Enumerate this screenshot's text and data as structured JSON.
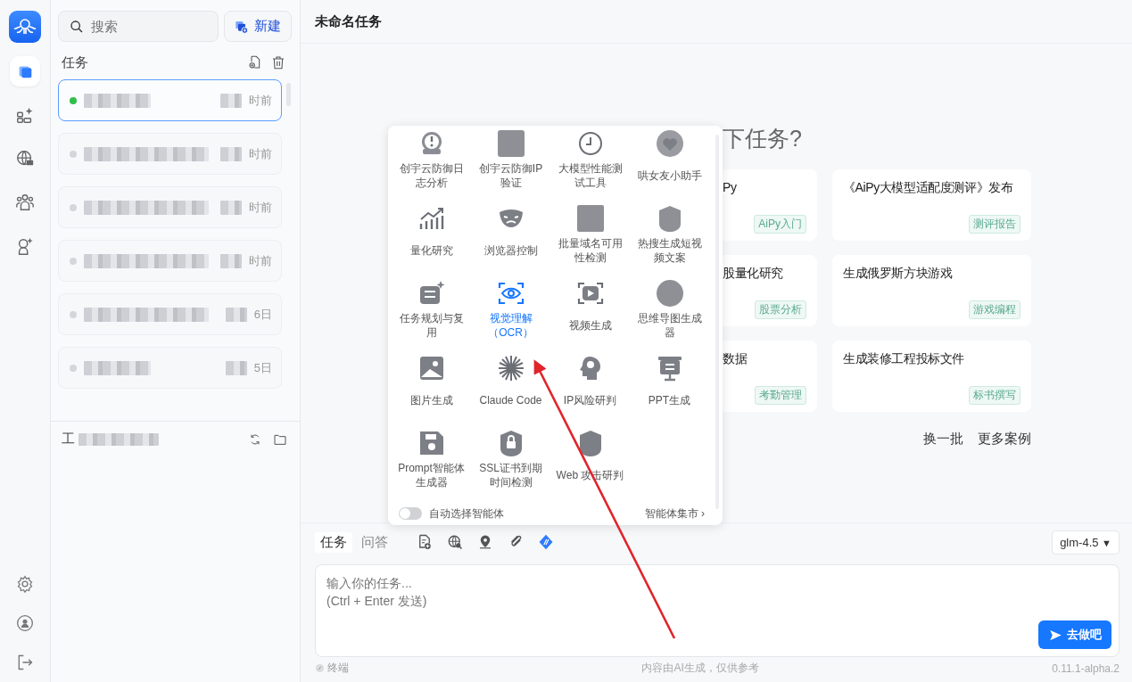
{
  "rail": {
    "items": [
      {
        "selected": true
      },
      {
        "selected": false
      },
      {
        "selected": false
      },
      {
        "selected": false
      },
      {
        "selected": false
      }
    ]
  },
  "sidebar": {
    "search": {
      "placeholder": "搜索"
    },
    "new_button": "新建",
    "section_title": "任务",
    "tasks": [
      {
        "time": "时前",
        "selected": true,
        "color": "#2fbf4a"
      },
      {
        "time": "时前",
        "selected": false,
        "color": "#d4d6da"
      },
      {
        "time": "时前",
        "selected": false,
        "color": "#d4d6da"
      },
      {
        "time": "时前",
        "selected": false,
        "color": "#d4d6da"
      },
      {
        "time": "6日",
        "selected": false,
        "color": "#d4d6da"
      },
      {
        "time": "5日",
        "selected": false,
        "color": "#d4d6da"
      }
    ],
    "workspace_label": "工"
  },
  "window": {
    "title": "未命名任务"
  },
  "welcome": {
    "heading": "下任务?",
    "cards": [
      {
        "title": "Py",
        "tag": "AiPy入门"
      },
      {
        "title": "《AiPy大模型适配度测评》发布",
        "tag": "测评报告"
      },
      {
        "title": "股量化研究",
        "tag": "股票分析"
      },
      {
        "title": "生成俄罗斯方块游戏",
        "tag": "游戏编程"
      },
      {
        "title": "数据",
        "tag": "考勤管理"
      },
      {
        "title": "生成装修工程投标文件",
        "tag": "标书撰写"
      }
    ],
    "links": [
      "换一批",
      "更多案例"
    ]
  },
  "agent_menu": {
    "items": [
      {
        "label": "创宇云防御日志分析",
        "selected": false
      },
      {
        "label": "创宇云防御IP验证",
        "selected": false
      },
      {
        "label": "大模型性能测试工具",
        "selected": false
      },
      {
        "label": "哄女友小助手",
        "selected": false
      },
      {
        "label": "量化研究",
        "selected": false
      },
      {
        "label": "浏览器控制",
        "selected": false
      },
      {
        "label": "批量域名可用性检测",
        "selected": false
      },
      {
        "label": "热搜生成短视频文案",
        "selected": false
      },
      {
        "label": "任务规划与复用",
        "selected": false
      },
      {
        "label": "视觉理解（OCR）",
        "selected": true
      },
      {
        "label": "视频生成",
        "selected": false
      },
      {
        "label": "思维导图生成器",
        "selected": false
      },
      {
        "label": "图片生成",
        "selected": false
      },
      {
        "label": "Claude Code",
        "selected": false
      },
      {
        "label": "IP风险研判",
        "selected": false
      },
      {
        "label": "PPT生成",
        "selected": false
      },
      {
        "label": "Prompt智能体生成器",
        "selected": false
      },
      {
        "label": "SSL证书到期时间检测",
        "selected": false
      },
      {
        "label": "Web 攻击研判",
        "selected": false
      }
    ],
    "auto_select": {
      "label": "自动选择智能体",
      "on": false
    },
    "market_link": "智能体集市 ›"
  },
  "composer": {
    "tabs": [
      {
        "label": "任务",
        "selected": true
      },
      {
        "label": "问答",
        "selected": false
      }
    ],
    "tools": [
      {
        "on": false
      },
      {
        "on": false
      },
      {
        "on": false
      },
      {
        "on": false
      },
      {
        "on": true
      }
    ],
    "model": {
      "value": "glm-4.5",
      "caret": "▼"
    },
    "placeholder": "输入你的任务...\n(Ctrl + Enter 发送)",
    "submit": "去做吧"
  },
  "status_bar": {
    "terminal": "终端",
    "notice": "内容由AI生成，仅供参考",
    "version": "0.11.1-alpha.2"
  }
}
